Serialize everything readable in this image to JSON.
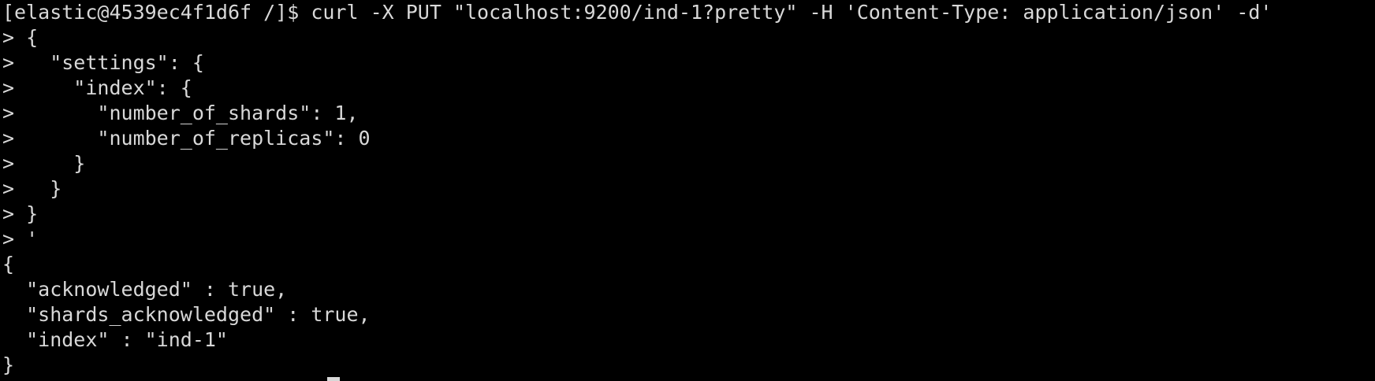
{
  "terminal": {
    "lines": [
      "[elastic@4539ec4f1d6f /]$ curl -X PUT \"localhost:9200/ind-1?pretty\" -H 'Content-Type: application/json' -d'",
      "> {",
      ">   \"settings\": {",
      ">     \"index\": {",
      ">       \"number_of_shards\": 1,",
      ">       \"number_of_replicas\": 0",
      ">     }",
      ">   }",
      "> }",
      "> '",
      "{",
      "  \"acknowledged\" : true,",
      "  \"shards_acknowledged\" : true,",
      "  \"index\" : \"ind-1\"",
      "}"
    ]
  },
  "colors": {
    "background": "#000000",
    "foreground": "#d8d8d8"
  }
}
